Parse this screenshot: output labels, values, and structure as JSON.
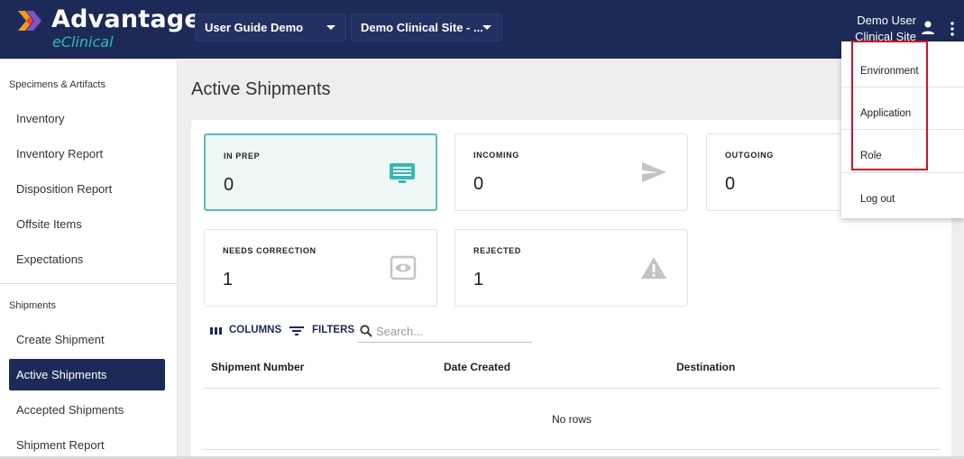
{
  "header": {
    "logo_title": "Advantage",
    "logo_subtitle": "eClinical",
    "study_select": "User Guide Demo",
    "site_select": "Demo Clinical Site - ...",
    "user_name": "Demo User",
    "user_site": "Clinical Site",
    "icons": [
      "logo-chevrons-icon",
      "caret-down-icon",
      "account-icon",
      "more-vertical-icon"
    ]
  },
  "sidebar": {
    "sections": [
      {
        "title": "Specimens & Artifacts",
        "items": [
          {
            "label": "Inventory"
          },
          {
            "label": "Inventory Report"
          },
          {
            "label": "Disposition Report"
          },
          {
            "label": "Offsite Items"
          },
          {
            "label": "Expectations"
          }
        ]
      },
      {
        "title": "Shipments",
        "items": [
          {
            "label": "Create Shipment"
          },
          {
            "label": "Active Shipments",
            "active": true
          },
          {
            "label": "Accepted Shipments"
          },
          {
            "label": "Shipment Report"
          }
        ]
      }
    ]
  },
  "main": {
    "title": "Active Shipments",
    "cards": [
      {
        "label": "IN PREP",
        "count": "0",
        "icon": "monitor-list-icon",
        "selected": true
      },
      {
        "label": "INCOMING",
        "count": "0",
        "icon": "send-icon"
      },
      {
        "label": "OUTGOING",
        "count": "0",
        "icon": "outgoing-icon"
      },
      {
        "label": "NEEDS CORRECTION",
        "count": "1",
        "icon": "eye-icon"
      },
      {
        "label": "REJECTED",
        "count": "1",
        "icon": "warning-icon"
      }
    ],
    "toolbar": {
      "columns_label": "COLUMNS",
      "filters_label": "FILTERS",
      "search_placeholder": "Search...",
      "search_value": ""
    },
    "table": {
      "columns": [
        "Shipment Number",
        "Date Created",
        "Destination"
      ],
      "empty_text": "No rows"
    }
  },
  "menu": {
    "items": [
      {
        "label": "Environment"
      },
      {
        "label": "Application"
      },
      {
        "label": "Role"
      },
      {
        "label": "Log out"
      }
    ]
  },
  "colors": {
    "header_bg": "#1d2a57",
    "accent_teal": "#35b9b0",
    "selected_card_border": "#5bbcb8",
    "highlight_red": "#d0102b",
    "logo_orange": "#f39a1e",
    "logo_purple": "#8a59d4"
  }
}
